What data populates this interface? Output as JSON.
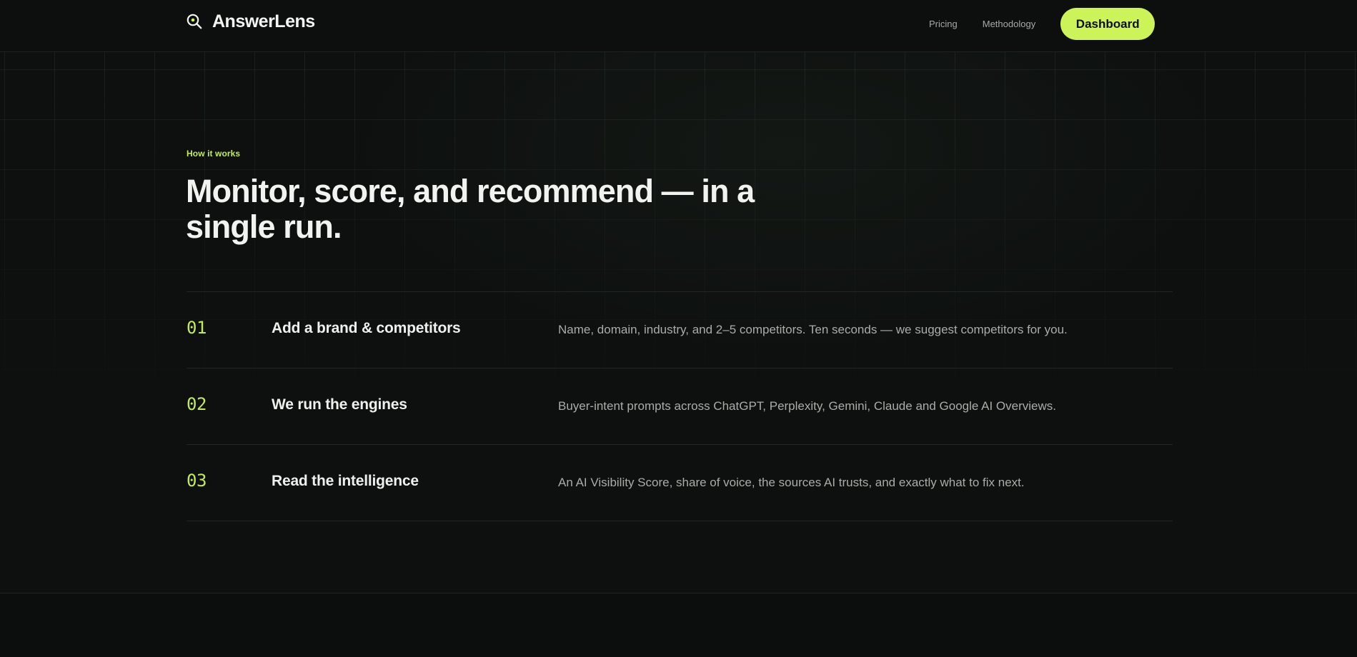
{
  "nav": {
    "brand_name": "AnswerLens",
    "brand_icon": "magnifier-icon",
    "links": [
      "Pricing",
      "Methodology"
    ],
    "cta_label": "Dashboard"
  },
  "colors": {
    "accent": "#ccf358",
    "background": "#0c0e0d",
    "text": "#eef0ee",
    "muted_text": "#a9ada8"
  },
  "section": {
    "eyebrow": "How it works",
    "headline": "Monitor, score, and recommend — in a single run.",
    "steps": [
      {
        "number": "01",
        "title": "Add a brand & competitors",
        "description": "Name, domain, industry, and 2–5 competitors. Ten seconds — we suggest competitors for you."
      },
      {
        "number": "02",
        "title": "We run the engines",
        "description": "Buyer-intent prompts across ChatGPT, Perplexity, Gemini, Claude and Google AI Overviews."
      },
      {
        "number": "03",
        "title": "Read the intelligence",
        "description": "An AI Visibility Score, share of voice, the sources AI trusts, and exactly what to fix next."
      }
    ]
  }
}
